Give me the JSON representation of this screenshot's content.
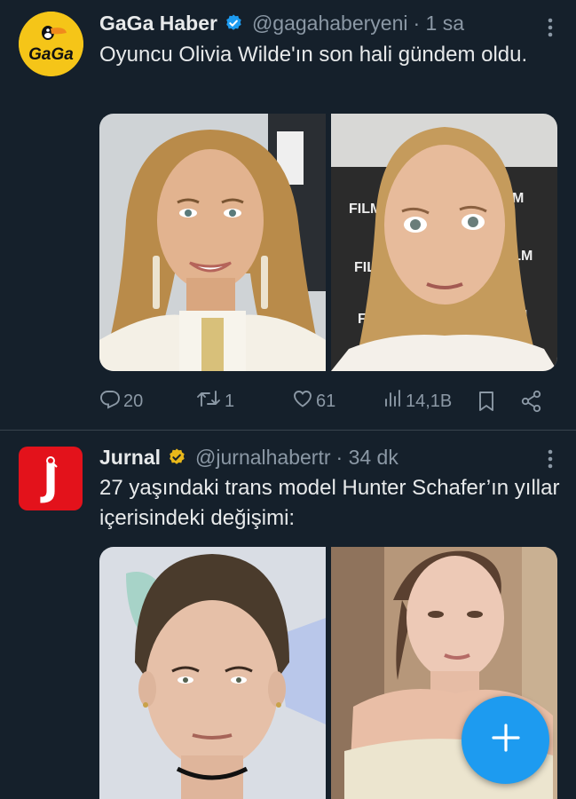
{
  "tweets": [
    {
      "author": "GaGa Haber",
      "handle": "@gagahaberyeni",
      "time": "· 1 sa",
      "text": "Oyuncu Olivia Wilde'ın son hali gündem oldu.",
      "avatar_text": "GaGa",
      "badge_color": "#1d9bf0",
      "images": [
        "olivia-wilde-red-carpet-photo",
        "olivia-wilde-press-wall-photo"
      ],
      "press_wall_text": "FILM",
      "stats": {
        "replies": "20",
        "retweets": "1",
        "likes": "61",
        "views": "14,1B"
      }
    },
    {
      "author": "Jurnal",
      "handle": "@jurnalhabertr",
      "time": "· 34 dk",
      "text": "27 yaşındaki trans model Hunter Schafer’ın yıllar içerisindeki değişimi:",
      "avatar_text": "J",
      "badge_color": "#e8b71a",
      "images": [
        "hunter-schafer-before-photo",
        "hunter-schafer-after-photo"
      ]
    }
  ],
  "fab": {
    "icon": "plus-icon",
    "color": "#1d9bf0"
  },
  "colors": {
    "background": "#15202b",
    "secondary_text": "#8b98a5",
    "divider": "#38444d"
  }
}
